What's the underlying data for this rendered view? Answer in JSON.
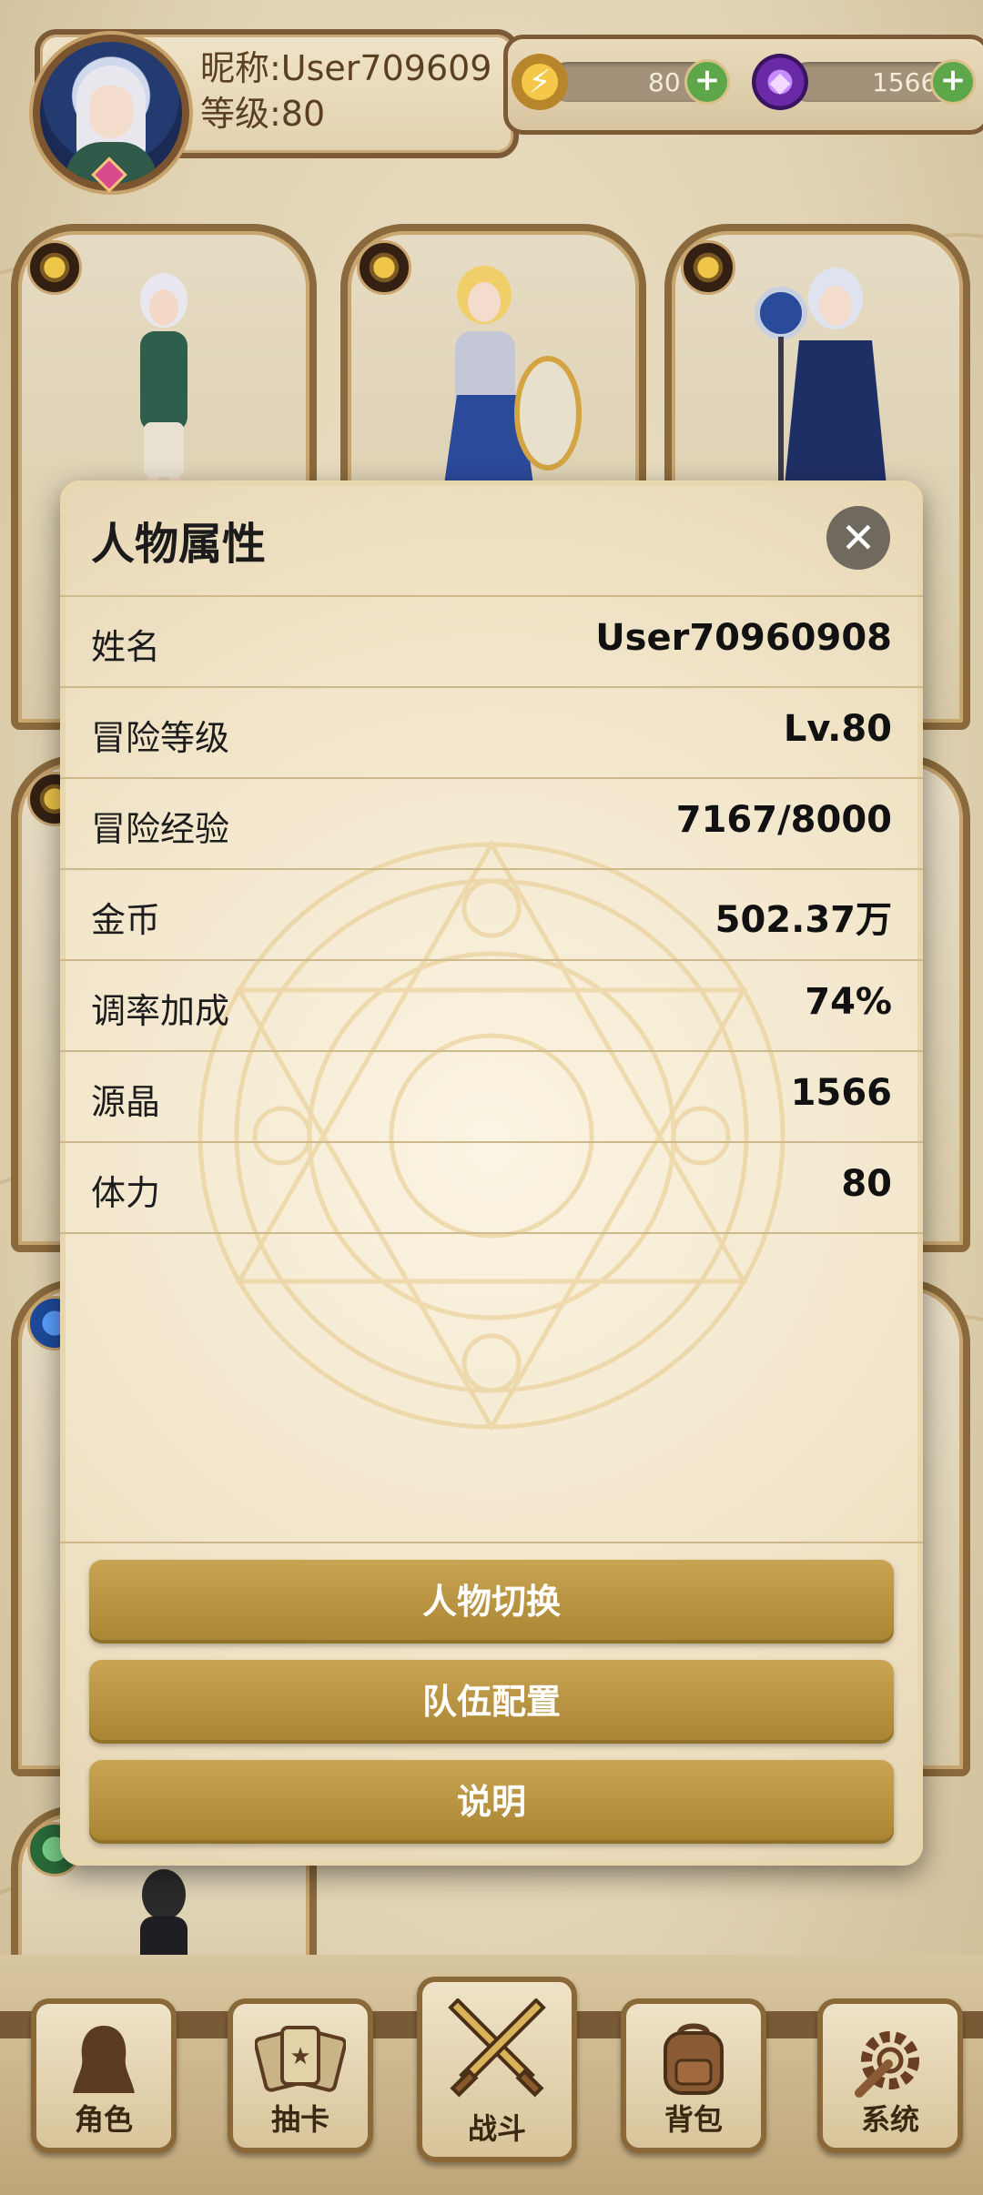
{
  "header": {
    "nickname_label": "昵称:User709609",
    "level_label": "等级:80",
    "energy": {
      "icon": "lightning-icon",
      "value": "80"
    },
    "crystal": {
      "icon": "purple-crystal-icon",
      "value": "1566"
    }
  },
  "modal": {
    "title": "人物属性",
    "close_symbol": "✕",
    "rows": [
      {
        "label": "姓名",
        "value": "User70960908"
      },
      {
        "label": "冒险等级",
        "value": "Lv.80"
      },
      {
        "label": "冒险经验",
        "value": "7167/8000"
      },
      {
        "label": "金币",
        "value": "502.37万"
      },
      {
        "label": "调率加成",
        "value": "74%"
      },
      {
        "label": "源晶",
        "value": "1566"
      },
      {
        "label": "体力",
        "value": "80"
      }
    ],
    "buttons": [
      {
        "label": "人物切换"
      },
      {
        "label": "队伍配置"
      },
      {
        "label": "说明"
      }
    ]
  },
  "nav": {
    "items": [
      {
        "label": "角色",
        "icon": "character-silhouette-icon",
        "active": false
      },
      {
        "label": "抽卡",
        "icon": "cards-icon",
        "active": false
      },
      {
        "label": "战斗",
        "icon": "crossed-swords-icon",
        "active": true
      },
      {
        "label": "背包",
        "icon": "backpack-icon",
        "active": false
      },
      {
        "label": "系统",
        "icon": "gear-wrench-icon",
        "active": false
      }
    ]
  },
  "colors": {
    "accent_gold": "#b8923e",
    "frame_brown": "#7d5a36",
    "plus_green": "#5da74a",
    "parchment": "#f2e6cb"
  }
}
